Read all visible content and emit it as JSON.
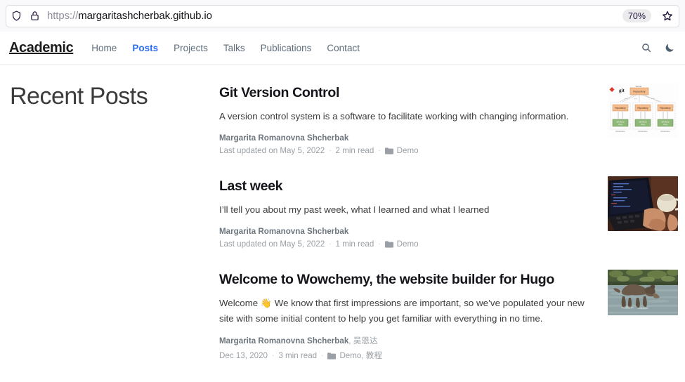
{
  "browser": {
    "url_scheme": "https://",
    "url_host": "margaritashcherbak.github.io",
    "zoom_level": "70%",
    "shield_icon": "shield-icon",
    "lock_icon": "lock-icon",
    "star_icon": "bookmark-star-icon"
  },
  "navbar": {
    "brand": "Academic",
    "links": [
      {
        "label": "Home",
        "active": false
      },
      {
        "label": "Posts",
        "active": true
      },
      {
        "label": "Projects",
        "active": false
      },
      {
        "label": "Talks",
        "active": false
      },
      {
        "label": "Publications",
        "active": false
      },
      {
        "label": "Contact",
        "active": false
      }
    ],
    "search_icon": "search-icon",
    "dark_mode_icon": "moon-icon",
    "active_color": "#2b6cf6"
  },
  "page": {
    "title": "Recent Posts"
  },
  "posts": [
    {
      "title": "Git Version Control",
      "summary": "A version control system is a software to facilitate working with changing information.",
      "author": "Margarita Romanovna Shcherbak",
      "author_extra": "",
      "date": "Last updated on May 5, 2022",
      "read_time": "2 min read",
      "categories": "Demo",
      "thumb_name": "git-workflow-diagram",
      "thumb_alt": "Git distributed workflow diagram with server repository and three workstations"
    },
    {
      "title": "Last week",
      "summary": "I’ll tell you about my past week, what I learned and what I learned",
      "author": "Margarita Romanovna Shcherbak",
      "author_extra": "",
      "date": "Last updated on May 5, 2022",
      "read_time": "1 min read",
      "categories": "Demo",
      "thumb_name": "laptop-typing-photo",
      "thumb_alt": "Hands typing on a laptop next to a coffee mug"
    },
    {
      "title": "Welcome to Wowchemy, the website builder for Hugo",
      "summary_before": "Welcome ",
      "summary_emoji": "👋",
      "summary_after": " We know that first impressions are important, so we’ve populated your new site with some initial content to help you get familiar with everything in no time.",
      "author": "Margarita Romanovna Shcherbak",
      "author_separator": ", ",
      "author_extra": "吴恩达",
      "date": "Dec 13, 2020",
      "read_time": "3 min read",
      "categories": "Demo, 教程",
      "thumb_name": "dog-in-river-photo",
      "thumb_alt": "Dog walking through a shallow river"
    }
  ]
}
